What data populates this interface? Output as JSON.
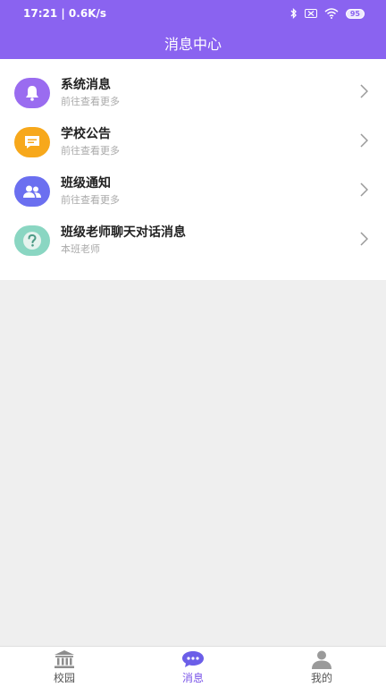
{
  "status": {
    "time_speed": "17:21 | 0.6K/s",
    "battery": "95"
  },
  "header": {
    "title": "消息中心"
  },
  "items": [
    {
      "title": "系统消息",
      "subtitle": "前往查看更多",
      "icon": "bell-icon",
      "color": "#9a6cf0"
    },
    {
      "title": "学校公告",
      "subtitle": "前往查看更多",
      "icon": "announcement-icon",
      "color": "#f7a81b"
    },
    {
      "title": "班级通知",
      "subtitle": "前往查看更多",
      "icon": "users-icon",
      "color": "#6b6ff0"
    },
    {
      "title": "班级老师聊天对话消息",
      "subtitle": "本班老师",
      "icon": "question-icon",
      "color": "#8ad6c2"
    }
  ],
  "tabs": [
    {
      "label": "校园",
      "icon": "campus-icon"
    },
    {
      "label": "消息",
      "icon": "message-icon",
      "active": true
    },
    {
      "label": "我的",
      "icon": "profile-icon"
    }
  ],
  "colors": {
    "accent": "#8a63f0",
    "active_tab": "#7a55e8"
  }
}
